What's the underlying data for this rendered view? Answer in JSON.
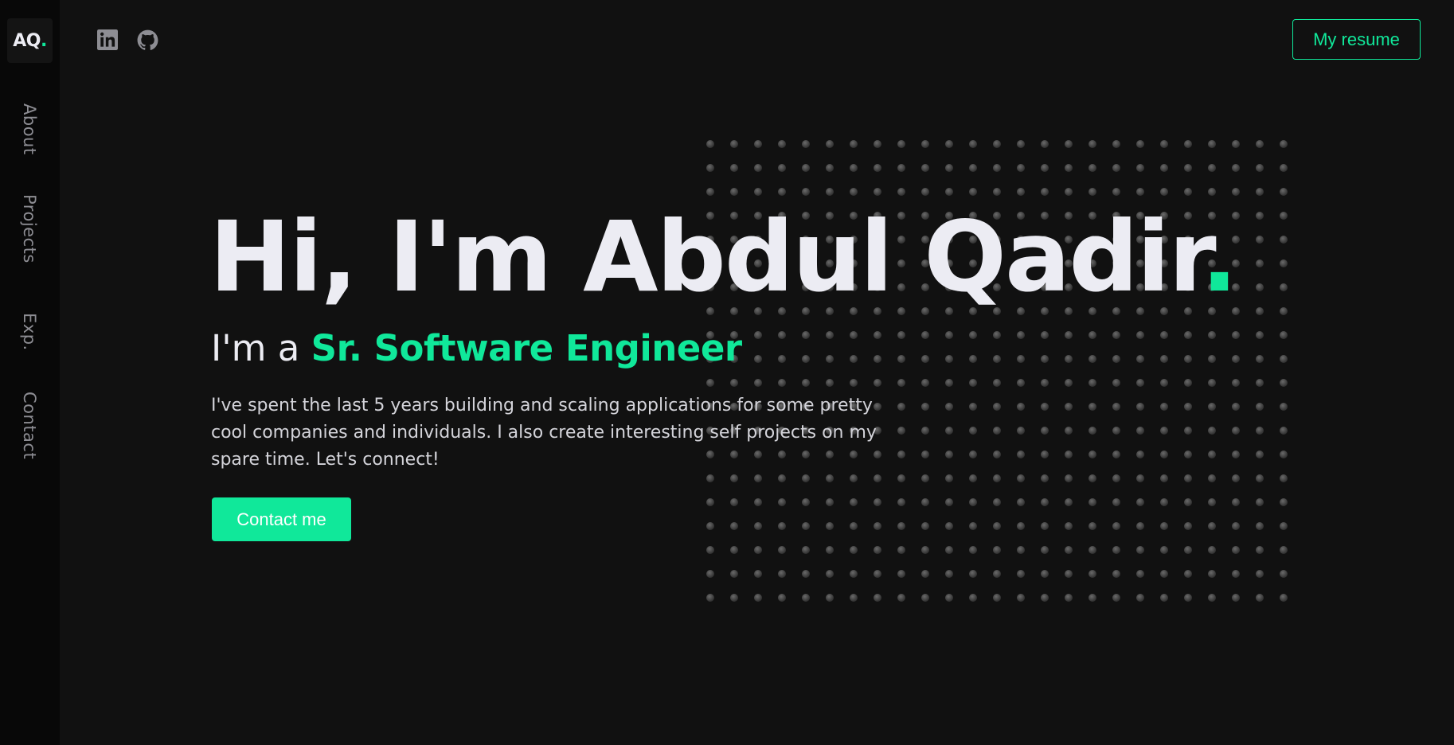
{
  "sidebar": {
    "logo": {
      "text": "AQ",
      "dot": "."
    },
    "nav": [
      {
        "label": "About"
      },
      {
        "label": "Projects"
      },
      {
        "label": "Exp."
      },
      {
        "label": "Contact"
      }
    ]
  },
  "header": {
    "social_icons": [
      "linkedin-icon",
      "github-icon"
    ],
    "resume_label": "My resume"
  },
  "hero": {
    "title": "Hi, I'm Abdul Qadir",
    "title_dot": ".",
    "subtitle_prefix": "I'm a ",
    "subtitle_role": "Sr. Software Engineer",
    "description": "I've spent the last 5 years building and scaling applications for some pretty cool companies and individuals. I also create interesting self projects on my spare time. Let's connect!",
    "contact_label": "Contact me"
  },
  "colors": {
    "background": "#111111",
    "sidebar": "#080808",
    "accent": "#10e89a",
    "text": "#ececf3",
    "muted": "#8d8d93"
  }
}
